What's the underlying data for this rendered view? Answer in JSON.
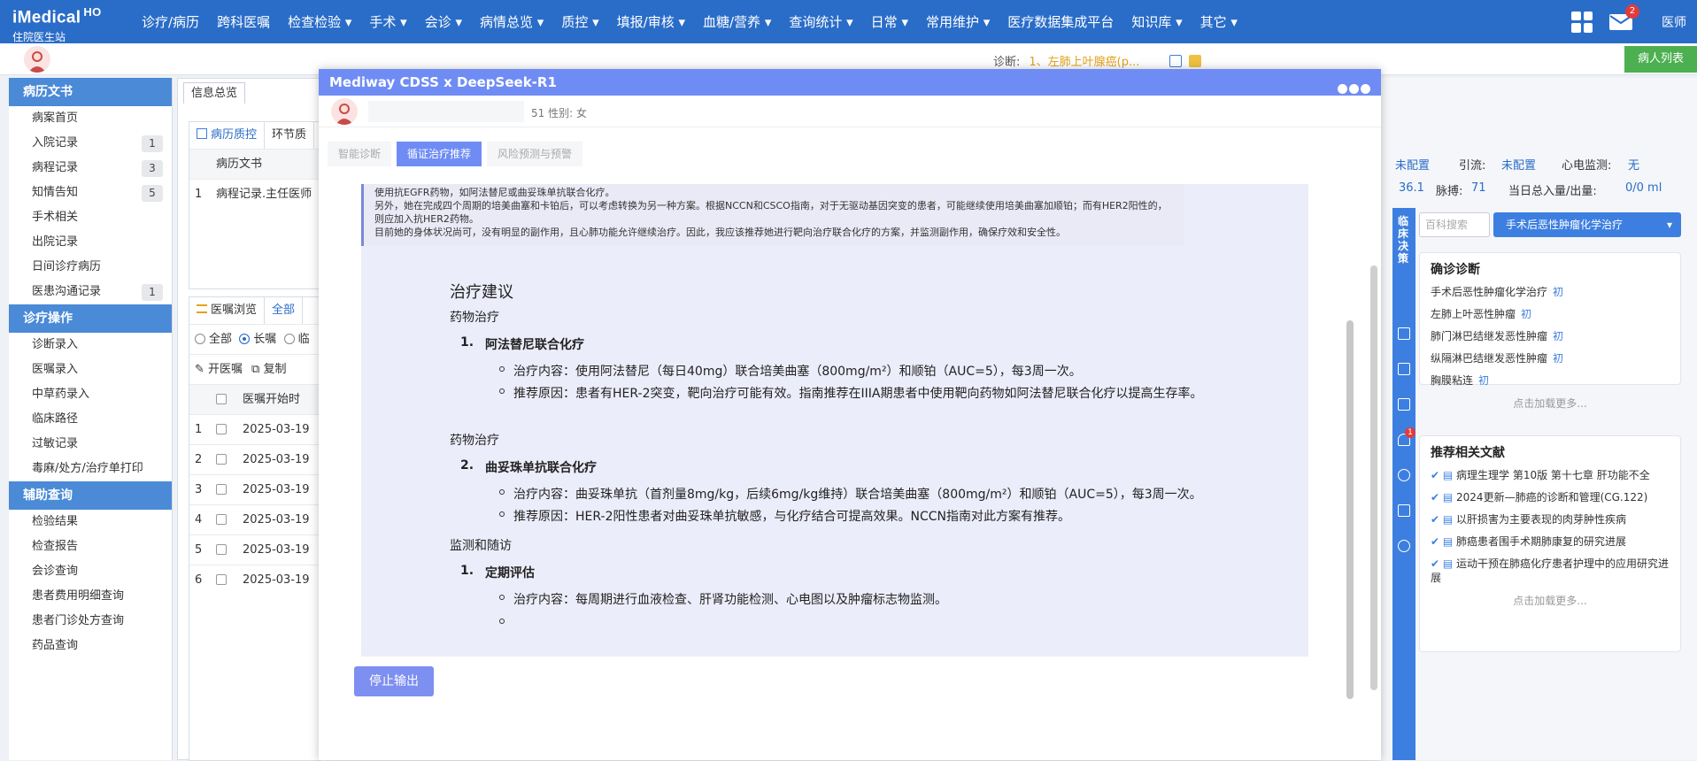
{
  "app": {
    "brand": "iMedical",
    "brand_suffix": "HO",
    "subtitle": "住院医生站",
    "username": "医师",
    "notifications": "2"
  },
  "menu": [
    "诊疗/病历",
    "跨科医嘱",
    "检查检验 ▾",
    "手术 ▾",
    "会诊 ▾",
    "病情总览 ▾",
    "质控 ▾",
    "填报/审核 ▾",
    "血糖/营养 ▾",
    "查询统计 ▾",
    "日常 ▾",
    "常用维护 ▾",
    "医疗数据集成平台",
    "知识库 ▾",
    "其它 ▾"
  ],
  "subbar": {
    "diag_label": "诊断:",
    "diag_value": "1、左肺上叶腺癌(p...",
    "patient_list": "病人列表"
  },
  "sidebar": {
    "sections": [
      {
        "title": "病历文书",
        "items": [
          {
            "label": "病案首页",
            "count": ""
          },
          {
            "label": "入院记录",
            "count": "1"
          },
          {
            "label": "病程记录",
            "count": "3"
          },
          {
            "label": "知情告知",
            "count": "5"
          },
          {
            "label": "手术相关",
            "count": ""
          },
          {
            "label": "出院记录",
            "count": ""
          },
          {
            "label": "日间诊疗病历",
            "count": ""
          },
          {
            "label": "医患沟通记录",
            "count": "1"
          }
        ]
      },
      {
        "title": "诊疗操作",
        "items": [
          {
            "label": "诊断录入"
          },
          {
            "label": "医嘱录入"
          },
          {
            "label": "中草药录入"
          },
          {
            "label": "临床路径"
          },
          {
            "label": "过敏记录"
          },
          {
            "label": "毒麻/处方/治疗单打印"
          }
        ]
      },
      {
        "title": "辅助查询",
        "items": [
          {
            "label": "检验结果"
          },
          {
            "label": "检查报告"
          },
          {
            "label": "会诊查询"
          },
          {
            "label": "患者费用明细查询"
          },
          {
            "label": "患者门诊处方查询"
          },
          {
            "label": "药品查询"
          }
        ]
      }
    ]
  },
  "center": {
    "tab": "信息总览",
    "p1_tabs": [
      "病历质控",
      "环节质"
    ],
    "p1_header": "病历文书",
    "p1_row": {
      "n": "1",
      "text": "病程记录.主任医师"
    },
    "p2_tabs": [
      "医嘱浏览",
      "全部"
    ],
    "radios": [
      "全部",
      "长嘱",
      "临"
    ],
    "actions": [
      "开医嘱",
      "复制"
    ],
    "col_header": "医嘱开始时",
    "rows": [
      {
        "n": "1",
        "date": "2025-03-19"
      },
      {
        "n": "2",
        "date": "2025-03-19"
      },
      {
        "n": "3",
        "date": "2025-03-19"
      },
      {
        "n": "4",
        "date": "2025-03-19"
      },
      {
        "n": "5",
        "date": "2025-03-19"
      },
      {
        "n": "6",
        "date": "2025-03-19"
      }
    ]
  },
  "bg_right": {
    "r1": [
      {
        "k": "未配置",
        "blue": true
      },
      {
        "k": "引流:",
        "blue": false
      },
      {
        "k": "未配置",
        "blue": true
      },
      {
        "k": "心电监测:",
        "blue": false
      },
      {
        "k": "无",
        "blue": true
      }
    ],
    "r2": [
      {
        "k": "36.1",
        "blue": true
      },
      {
        "k": "脉搏:",
        "blue": false
      },
      {
        "k": "71",
        "blue": true
      },
      {
        "k": "当日总入量/出量:",
        "blue": false
      },
      {
        "k": "0/0 ml",
        "blue": true
      }
    ]
  },
  "strip": {
    "label": "临床决策",
    "badge": "1"
  },
  "right_panel": {
    "search_placeholder": "百科搜索",
    "select_value": "手术后恶性肿瘤化学治疗",
    "confirm": {
      "title": "确诊诊断",
      "items": [
        {
          "text": "手术后恶性肿瘤化学治疗",
          "tag": "初"
        },
        {
          "text": "左肺上叶恶性肿瘤",
          "tag": "初"
        },
        {
          "text": "肺门淋巴结继发恶性肿瘤",
          "tag": "初"
        },
        {
          "text": "纵隔淋巴结继发恶性肿瘤",
          "tag": "初"
        },
        {
          "text": "胸膜粘连",
          "tag": "初"
        }
      ],
      "more": "点击加载更多..."
    },
    "lit": {
      "title": "推荐相关文献",
      "items": [
        "病理生理学 第10版 第十七章 肝功能不全",
        "2024更新—肺癌的诊断和管理(CG.122)",
        "以肝损害为主要表现的肉芽肿性疾病",
        "肺癌患者围手术期肺康复的研究进展",
        "运动干预在肺癌化疗患者护理中的应用研究进展"
      ],
      "more": "点击加载更多..."
    }
  },
  "modal": {
    "title": "Mediway CDSS x DeepSeek-R1",
    "patient_meta": "51  性别: 女",
    "tabs": [
      "智能诊断",
      "循证治疗推荐",
      "风险预测与预警"
    ],
    "quote": [
      "使用抗EGFR药物，如阿法替尼或曲妥珠单抗联合化疗。",
      "另外，她在完成四个周期的培美曲塞和卡铂后，可以考虑转换为另一种方案。根据NCCN和CSCO指南，对于无驱动基因突变的患者，可能继续使用培美曲塞加顺铂；而有HER2阳性的，则应加入抗HER2药物。",
      "目前她的身体状况尚可，没有明显的副作用，且心肺功能允许继续治疗。因此，我应该推荐她进行靶向治疗联合化疗的方案，并监测副作用，确保疗效和安全性。"
    ],
    "heading": "治疗建议",
    "drug_label": "药物治疗",
    "drug1": {
      "num": "1.",
      "name": "阿法替尼联合化疗",
      "content": "治疗内容：使用阿法替尼（每日40mg）联合培美曲塞（800mg/m²）和顺铂（AUC=5），每3周一次。",
      "reason": "推荐原因：患者有HER-2突变，靶向治疗可能有效。指南推荐在IIIA期患者中使用靶向药物如阿法替尼联合化疗以提高生存率。"
    },
    "drug2": {
      "num": "2.",
      "name": "曲妥珠单抗联合化疗",
      "content": "治疗内容：曲妥珠单抗（首剂量8mg/kg，后续6mg/kg维持）联合培美曲塞（800mg/m²）和顺铂（AUC=5），每3周一次。",
      "reason": "推荐原因：HER-2阳性患者对曲妥珠单抗敏感，与化疗结合可提高效果。NCCN指南对此方案有推荐。"
    },
    "monitor_label": "监测和随访",
    "monitor": {
      "num": "1.",
      "name": "定期评估",
      "content": "治疗内容：每周期进行血液检查、肝肾功能检测、心电图以及肿瘤标志物监测。"
    },
    "stop_button": "停止输出"
  }
}
